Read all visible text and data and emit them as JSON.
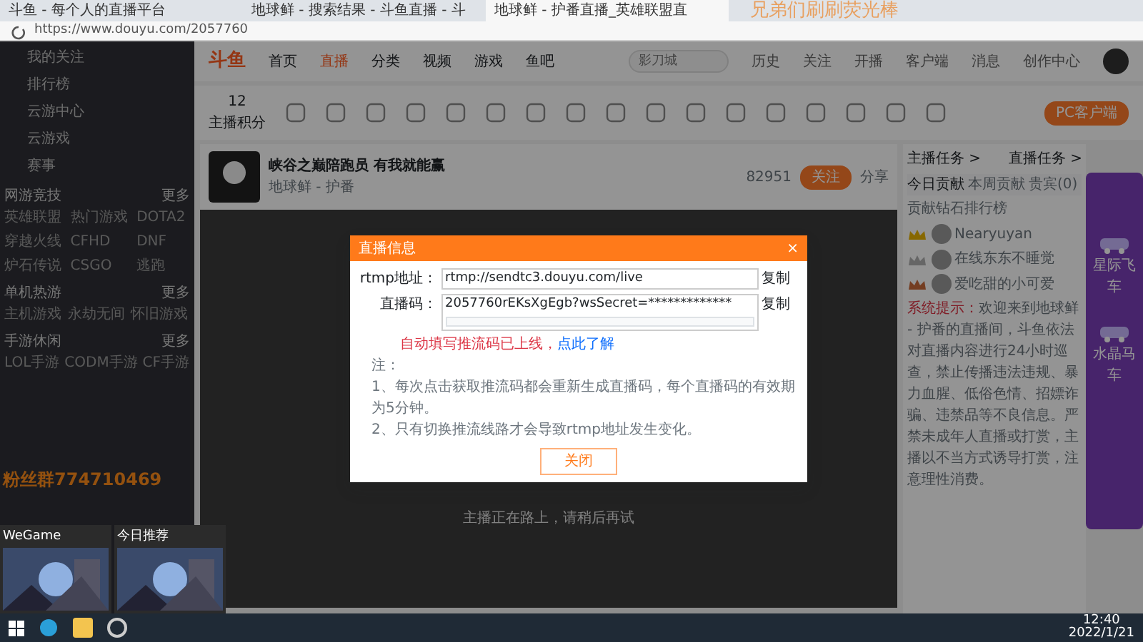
{
  "browser": {
    "tabs": [
      {
        "title": "斗鱼 - 每个人的直播平台",
        "selected": false
      },
      {
        "title": "地球鲜 - 搜索结果 - 斗鱼直播 - 斗",
        "selected": false
      },
      {
        "title": "地球鲜 - 护番直播_英雄联盟直",
        "selected": true
      }
    ],
    "url": "https://www.douyu.com/2057760"
  },
  "overlay_text": "兄弟们刷刷荧光棒",
  "fan_group_text": "粉丝群774710469",
  "sidebar": {
    "items": [
      "我的关注",
      "排行榜",
      "云游中心",
      "云游戏",
      "赛事"
    ],
    "sections": [
      {
        "title": "网游竞技",
        "more": "更多",
        "games": [
          "英雄联盟",
          "热门游戏",
          "DOTA2",
          "穿越火线",
          "CFHD",
          "DNF",
          "炉石传说",
          "CSGO",
          "逃跑"
        ]
      },
      {
        "title": "单机热游",
        "more": "更多",
        "games": [
          "主机游戏",
          "永劫无间",
          "怀旧游戏"
        ]
      },
      {
        "title": "手游休闲",
        "more": "更多",
        "games": [
          "LOL手游",
          "CODM手游",
          "CF手游"
        ]
      }
    ]
  },
  "nav": {
    "logo": "斗鱼",
    "items": [
      {
        "label": "首页",
        "selected": false
      },
      {
        "label": "直播",
        "selected": true
      },
      {
        "label": "分类",
        "selected": false
      },
      {
        "label": "视频",
        "selected": false
      },
      {
        "label": "游戏",
        "selected": false
      },
      {
        "label": "鱼吧",
        "selected": false
      }
    ],
    "search_placeholder": "影刀城",
    "user_links": [
      "历史",
      "关注",
      "开播",
      "客户端",
      "消息",
      "创作中心"
    ]
  },
  "toolbar": {
    "points": "12",
    "points_label": "主播积分",
    "client_button": "PC客户端"
  },
  "streamer": {
    "title": "峡谷之巅陪跑员 有我就能赢",
    "name": "地球鲜 - 护番",
    "follow_count": "82951",
    "follow_button": "关注",
    "share": "分享"
  },
  "video": {
    "message": "主播正在路上，请稍后再试"
  },
  "modal": {
    "title": "直播信息",
    "close": "×",
    "fields": [
      {
        "label": "rtmp地址：",
        "value": "rtmp://sendtc3.douyu.com/live",
        "copy": "复制",
        "kind": "input"
      },
      {
        "label": "直播码：",
        "value": "2057760rEKsXgEgb?wsSecret=*************",
        "copy": "复制",
        "kind": "textarea"
      }
    ],
    "warning": "自动填写推流码已上线，",
    "link": "点此了解",
    "notes": [
      "注：",
      "1、每次点击获取推流码都会重新生成直播码，每个直播码的有效期为5分钟。",
      "2、只有切换推流线路才会导致rtmp地址发生变化。"
    ],
    "button": "关闭"
  },
  "panel": {
    "links": [
      "主播任务 >",
      "直播任务 >"
    ],
    "tabs": [
      {
        "label": "今日贡献",
        "selected": true
      },
      {
        "label": "本周贡献",
        "selected": false
      },
      {
        "label": "贵宾(0)",
        "selected": false
      }
    ],
    "rank_title": "贡献钻石排行榜",
    "ranking": [
      {
        "name": "Nearyuyan"
      },
      {
        "name": "在线东东不睡觉"
      },
      {
        "name": "爱吃甜的小可爱"
      }
    ],
    "notice_label": "系统提示：",
    "notice": "欢迎来到地球鲜 - 护番的直播间，斗鱼依法对直播内容进行24小时巡查，禁止传播违法违规、暴力血腥、低俗色情、招嫖诈骗、违禁品等不良信息。严禁未成年人直播或打赏，主播以不当方式诱导打赏，注意理性消费。"
  },
  "gift_banner": {
    "items": [
      "星际飞车",
      "水晶马车"
    ]
  },
  "taskbar": {
    "previews": [
      {
        "title": "WeGame"
      },
      {
        "title": "今日推荐"
      }
    ],
    "time": "12:40",
    "date": "2022/1/21"
  }
}
